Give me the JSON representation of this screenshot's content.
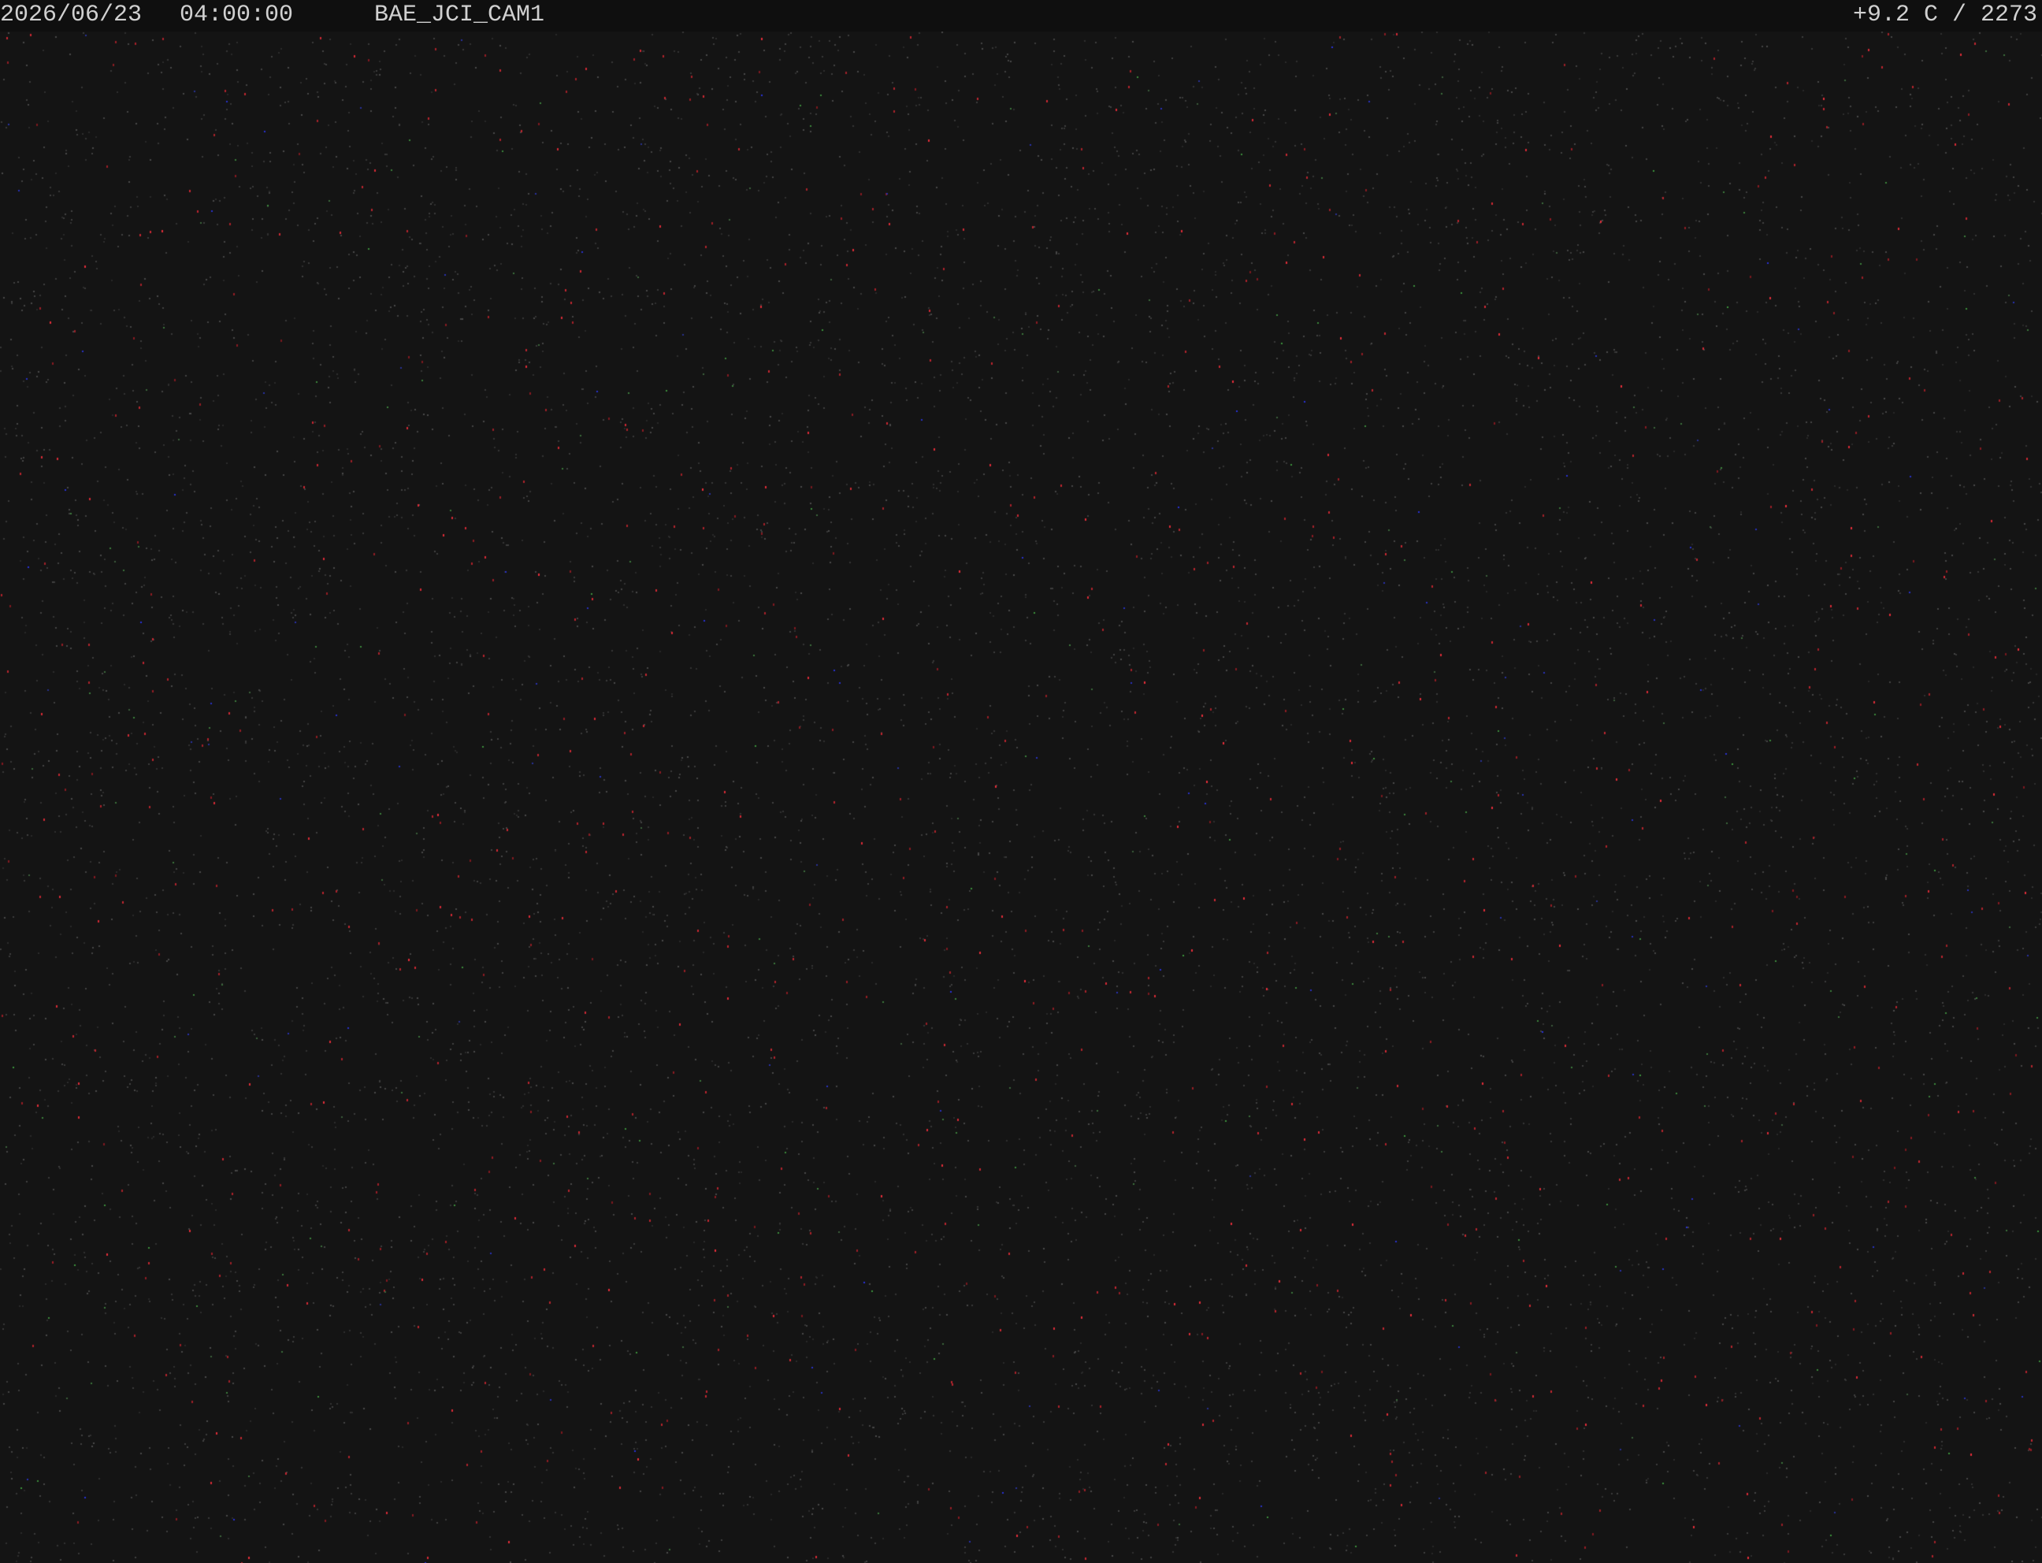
{
  "overlay": {
    "date": "2026/06/23",
    "time": "04:00:00",
    "camera_id": "BAE_JCI_CAM1",
    "readout": "+9.2 C / 2273"
  },
  "image": {
    "background_color": "#141414",
    "scene": "night sky camera frame with sensor noise"
  }
}
